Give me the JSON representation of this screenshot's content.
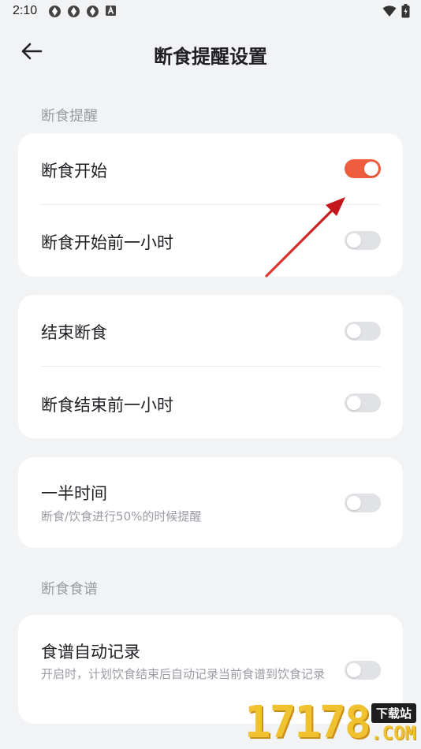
{
  "status_bar": {
    "time": "2:10",
    "notification_icons": [
      "aperture-icon",
      "aperture-icon",
      "aperture-icon",
      "a-box-icon"
    ],
    "right_icons": [
      "wifi-icon",
      "battery-icon"
    ]
  },
  "header": {
    "back_icon": "arrow-left-icon",
    "title": "断食提醒设置"
  },
  "sections": {
    "fasting_reminder_label": "断食提醒",
    "fasting_recipe_label": "断食食谱"
  },
  "card1": {
    "rows": [
      {
        "label": "断食开始",
        "enabled": true
      },
      {
        "label": "断食开始前一小时",
        "enabled": false
      }
    ]
  },
  "card2": {
    "rows": [
      {
        "label": "结束断食",
        "enabled": false
      },
      {
        "label": "断食结束前一小时",
        "enabled": false
      }
    ]
  },
  "card3": {
    "label": "一半时间",
    "sub": "断食/饮食进行50%的时候提醒",
    "enabled": false
  },
  "card4": {
    "label": "食谱自动记录",
    "sub": "开启时，计划饮食结束后自动记录当前食谱到饮食记录",
    "enabled": false
  },
  "watermark": {
    "digits": "17178",
    "tag": "下载站",
    "domain": ".COM"
  },
  "colors": {
    "accent": "#ef5d3f",
    "toggle_off": "#e1e2e6",
    "annotation_arrow": "#d4181c",
    "background": "#f2f3f5"
  }
}
